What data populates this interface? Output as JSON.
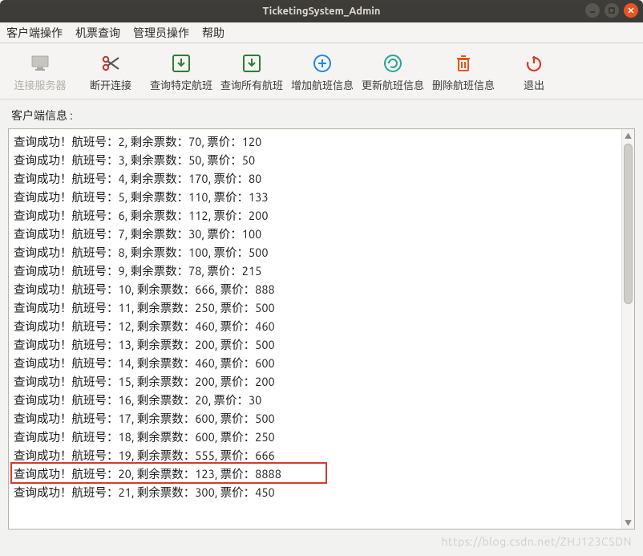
{
  "window": {
    "title": "TicketingSystem_Admin"
  },
  "menubar": [
    "客户端操作",
    "机票查询",
    "管理员操作",
    "帮助"
  ],
  "toolbar": {
    "connect": {
      "label": "连接服务器",
      "icon": "monitor-icon",
      "disabled": true
    },
    "disconnect": {
      "label": "断开连接",
      "icon": "scissors-icon"
    },
    "queryOne": {
      "label": "查询特定航班",
      "icon": "download-box-icon",
      "color": "#2e7d32"
    },
    "queryAll": {
      "label": "查询所有航班",
      "icon": "download-box-icon",
      "color": "#2e7d32"
    },
    "add": {
      "label": "增加航班信息",
      "icon": "plus-circle-icon",
      "color": "#1e88e5"
    },
    "update": {
      "label": "更新航班信息",
      "icon": "refresh-circle-icon",
      "color": "#26a69a"
    },
    "delete": {
      "label": "删除航班信息",
      "icon": "trash-icon",
      "color": "#e95420"
    },
    "exit": {
      "label": "退出",
      "icon": "power-icon",
      "color": "#d73a2f"
    }
  },
  "clientInfoLabel": "客户端信息 :",
  "linePrefix": "查询成功！航班号：",
  "ticketsLabel": ", 剩余票数：",
  "priceLabel": ", 票价：",
  "flights": [
    {
      "id": 2,
      "tickets": 70,
      "price": 120
    },
    {
      "id": 3,
      "tickets": 50,
      "price": 50
    },
    {
      "id": 4,
      "tickets": 170,
      "price": 80
    },
    {
      "id": 5,
      "tickets": 110,
      "price": 133
    },
    {
      "id": 6,
      "tickets": 112,
      "price": 200
    },
    {
      "id": 7,
      "tickets": 30,
      "price": 100
    },
    {
      "id": 8,
      "tickets": 100,
      "price": 500
    },
    {
      "id": 9,
      "tickets": 78,
      "price": 215
    },
    {
      "id": 10,
      "tickets": 666,
      "price": 888
    },
    {
      "id": 11,
      "tickets": 250,
      "price": 500
    },
    {
      "id": 12,
      "tickets": 460,
      "price": 460
    },
    {
      "id": 13,
      "tickets": 200,
      "price": 500
    },
    {
      "id": 14,
      "tickets": 460,
      "price": 600
    },
    {
      "id": 15,
      "tickets": 200,
      "price": 200
    },
    {
      "id": 16,
      "tickets": 20,
      "price": 30
    },
    {
      "id": 17,
      "tickets": 600,
      "price": 500
    },
    {
      "id": 18,
      "tickets": 600,
      "price": 250
    },
    {
      "id": 19,
      "tickets": 555,
      "price": 666
    },
    {
      "id": 20,
      "tickets": 123,
      "price": 8888,
      "highlighted": true
    },
    {
      "id": 21,
      "tickets": 300,
      "price": 450
    }
  ],
  "highlightedIndex": 18,
  "watermark": "https://blog.csdn.net/ZHJ123CSDN"
}
